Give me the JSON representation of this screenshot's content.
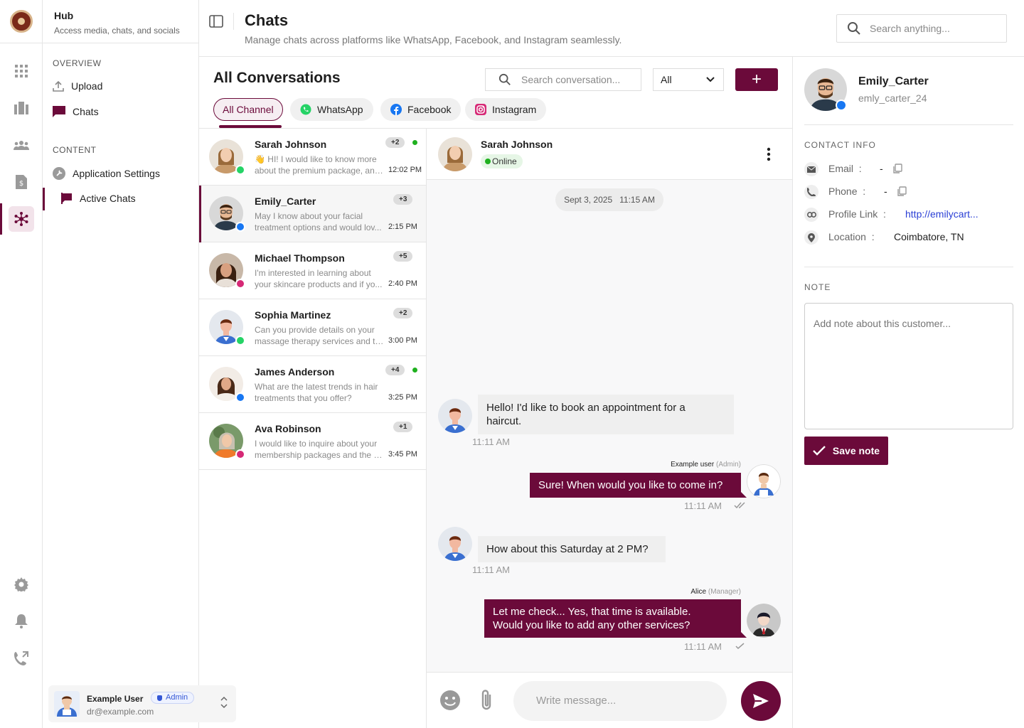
{
  "nav": {
    "hub_title": "Hub",
    "hub_subtitle": "Access media, chats, and socials",
    "overview_label": "OVERVIEW",
    "content_label": "CONTENT",
    "items": [
      {
        "label": "Upload",
        "icon": "upload-icon"
      },
      {
        "label": "Chats",
        "icon": "chat-bubble-icon"
      },
      {
        "label": "Application Settings",
        "icon": "settings-wrench-icon"
      },
      {
        "label": "Active Chats",
        "icon": "flag-chat-icon"
      }
    ]
  },
  "user": {
    "name": "Example User",
    "role": "Admin",
    "email": "dr@example.com"
  },
  "header": {
    "title": "Chats",
    "subtitle": "Manage chats across platforms like WhatsApp, Facebook, and Instagram seamlessly.",
    "search_placeholder": "Search anything..."
  },
  "conversations": {
    "title": "All Conversations",
    "search_placeholder": "Search conversation...",
    "filter_value": "All",
    "add_label": "+",
    "channels": [
      {
        "label": "All Channel",
        "active": true
      },
      {
        "label": "WhatsApp",
        "icon": "whatsapp-icon"
      },
      {
        "label": "Facebook",
        "icon": "facebook-icon"
      },
      {
        "label": "Instagram",
        "icon": "instagram-icon"
      }
    ],
    "list": [
      {
        "name": "Sarah Johnson",
        "line1": "👋 HI! I would like to know more",
        "line2": "about the premium package, and...",
        "count": "+2",
        "time": "12:02 PM",
        "online": true,
        "platform": "whatsapp"
      },
      {
        "name": "Emily_Carter",
        "line1": "May I know about your facial",
        "line2": "treatment options and would lov...",
        "count": "+3",
        "time": "2:15 PM",
        "online": false,
        "platform": "facebook"
      },
      {
        "name": "Michael Thompson",
        "line1": "I'm interested in learning about",
        "line2": "your skincare products and if yo...",
        "count": "+5",
        "time": "2:40 PM",
        "online": false,
        "platform": "instagram"
      },
      {
        "name": "Sophia Martinez",
        "line1": "Can you provide details on your",
        "line2": "massage therapy services and th...",
        "count": "+2",
        "time": "3:00 PM",
        "online": false,
        "platform": "whatsapp"
      },
      {
        "name": "James Anderson",
        "line1": "What are the latest trends in hair",
        "line2": "treatments that you offer?",
        "count": "+4",
        "time": "3:25 PM",
        "online": true,
        "platform": "facebook"
      },
      {
        "name": "Ava Robinson",
        "line1": "I would like to inquire about your",
        "line2": "membership packages and the d...",
        "count": "+1",
        "time": "3:45 PM",
        "online": false,
        "platform": "instagram"
      }
    ]
  },
  "chat": {
    "contact_name": "Sarah Johnson",
    "status": "Online",
    "date": "Sept 3, 2025",
    "date_time": "11:15 AM",
    "messages": [
      {
        "direction": "in",
        "line1": "Hello! I'd like to book an appointment for a",
        "line2": "haircut.",
        "time": "11:11 AM"
      },
      {
        "direction": "out",
        "sender": "Example user",
        "role": "(Admin)",
        "text": "Sure! When would you like to come in?",
        "time": "11:11 AM"
      },
      {
        "direction": "in",
        "text": "How about this Saturday at 2 PM?",
        "time": "11:11 AM"
      },
      {
        "direction": "out",
        "sender": "Alice",
        "role": "(Manager)",
        "line1": "Let me check... Yes, that time is available.",
        "line2": "Would you like to add any other services?",
        "time": "11:11 AM"
      }
    ],
    "composer_placeholder": "Write message..."
  },
  "contact": {
    "name": "Emily_Carter",
    "handle": "emly_carter_24",
    "info_title": "CONTACT INFO",
    "email_label": "Email",
    "email_value": "-",
    "phone_label": "Phone",
    "phone_value": "-",
    "profile_label": "Profile Link",
    "profile_value": "http://emilycart...",
    "location_label": "Location",
    "location_value": "Coimbatore, TN",
    "sep": ":",
    "note_title": "NOTE",
    "note_placeholder": "Add note about this customer...",
    "save_label": "Save note"
  },
  "colors": {
    "brand": "#6b0a3a",
    "online": "#1fb01f",
    "whatsapp": "#25d366",
    "facebook": "#1877f2",
    "instagram": "#d62976",
    "link": "#2a3fd5"
  }
}
